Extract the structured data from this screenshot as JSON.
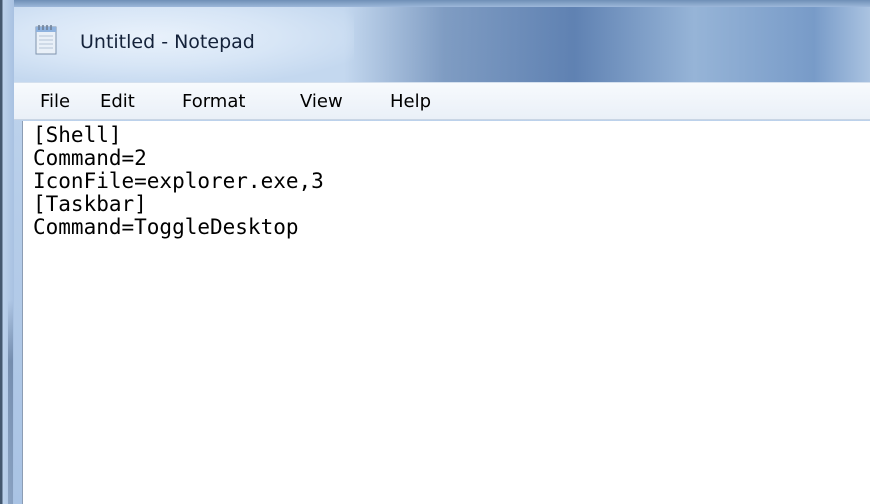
{
  "window": {
    "title": "Untitled - Notepad",
    "app_icon": "notepad-icon"
  },
  "menu": {
    "items": [
      {
        "label": "File"
      },
      {
        "label": "Edit"
      },
      {
        "label": "Format"
      },
      {
        "label": "View"
      },
      {
        "label": "Help"
      }
    ]
  },
  "editor": {
    "lines": [
      "[Shell]",
      "Command=2",
      "IconFile=explorer.exe,3",
      "[Taskbar]",
      "Command=ToggleDesktop"
    ]
  },
  "colors": {
    "frame": "#b6cde9",
    "title_text": "#14223a",
    "menu_background": "#eaf0f8",
    "editor_background": "#ffffff"
  }
}
